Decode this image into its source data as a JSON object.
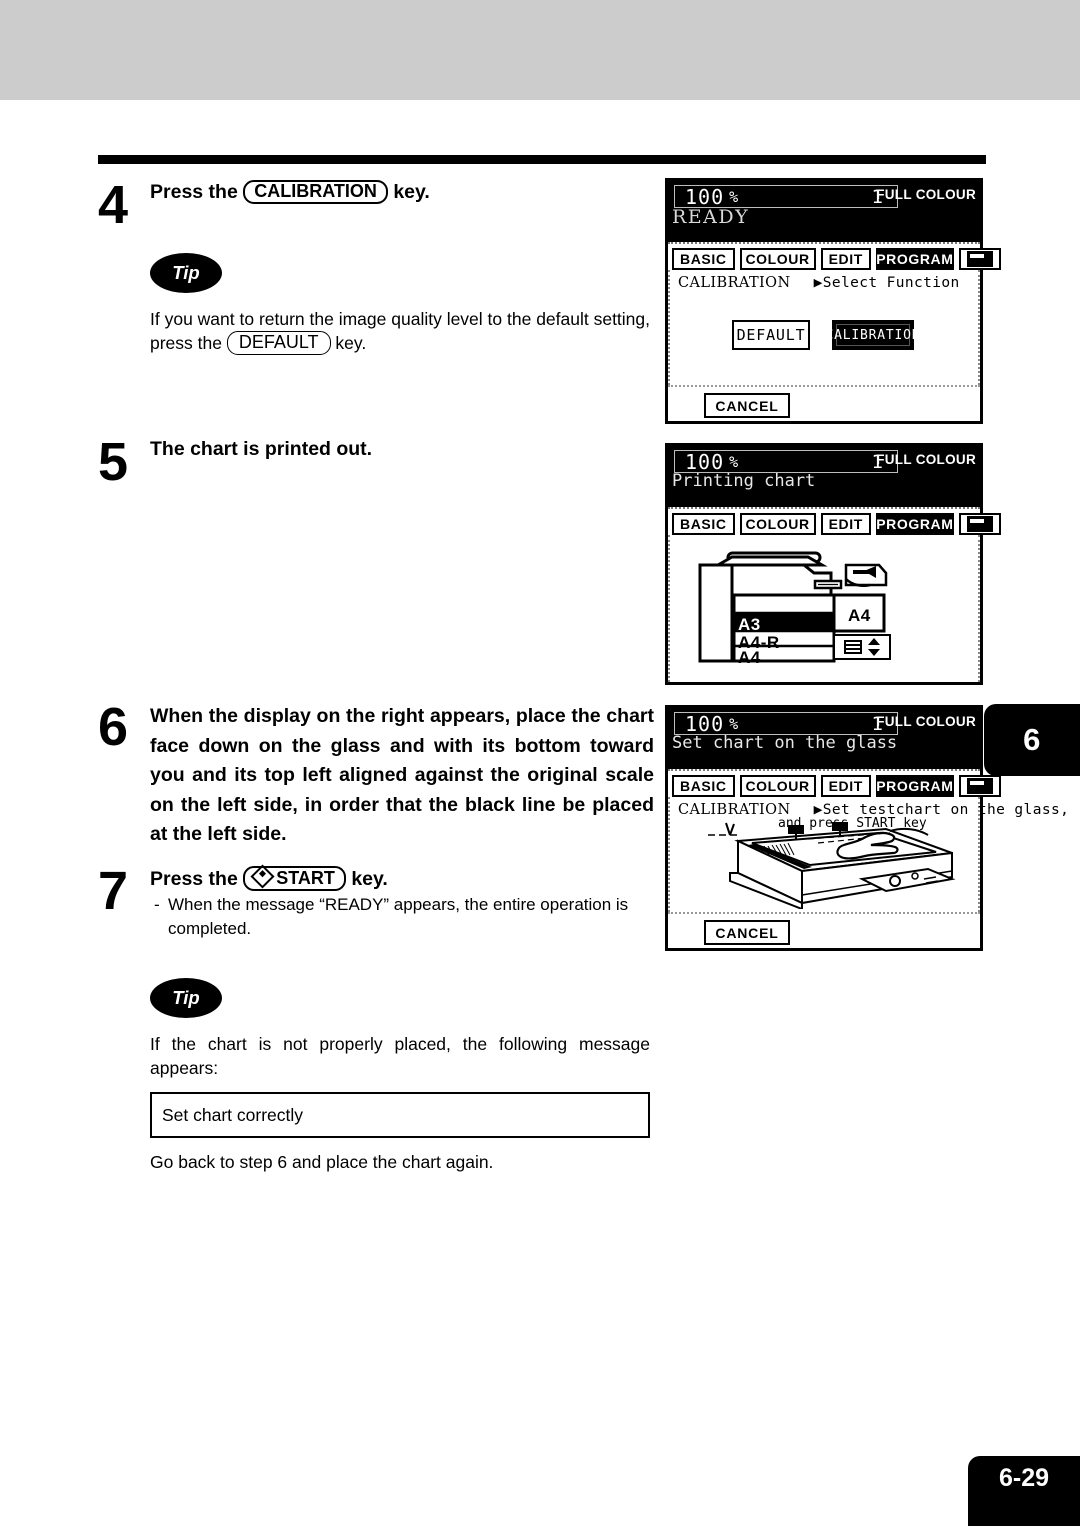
{
  "page": {
    "chapter_tab": "6",
    "page_number": "6-29"
  },
  "steps": [
    {
      "number": "4",
      "title_before": "Press the",
      "key": "CALIBRATION",
      "title_after": "key."
    },
    {
      "number": "5",
      "title": "The chart is printed out."
    },
    {
      "number": "6",
      "title": "When the display on the right appears, place the chart face down on the glass and with its bottom toward you and its top left aligned against the original scale on the left side, in order that the black line be placed at  the left side."
    },
    {
      "number": "7",
      "title_before": "Press the",
      "key": "START",
      "title_after": "key.",
      "dash": "-",
      "sub": "When the message “READY” appears,  the entire operation is completed."
    }
  ],
  "tips": [
    {
      "badge": "Tip",
      "text_before": "If you want to return the image quality level to the default setting, press the",
      "key": "DEFAULT",
      "text_after": "key."
    },
    {
      "badge": "Tip",
      "text": "If the chart is not properly placed, the following message appears:",
      "message_box": "Set chart correctly",
      "footer": "Go back to step 6 and place the chart again."
    }
  ],
  "lcd_panels": [
    {
      "id": "panel-calibration-select",
      "zoom": "100",
      "percent": "%",
      "copies": "1",
      "colour_mode": "FULL COLOUR",
      "message": "READY",
      "tabs": [
        {
          "label": "BASIC",
          "active": false
        },
        {
          "label": "COLOUR",
          "active": false
        },
        {
          "label": "EDIT",
          "active": false
        },
        {
          "label": "PROGRAM",
          "active": true
        },
        {
          "label": "keyboard-icon",
          "active": false
        }
      ],
      "function_label": "CALIBRATION",
      "function_prompt": "▶Select Function",
      "buttons": [
        {
          "label": "DEFAULT",
          "selected": false
        },
        {
          "label": "CALIBRATION",
          "selected": true
        }
      ],
      "cancel_label": "CANCEL"
    },
    {
      "id": "panel-printing-chart",
      "zoom": "100",
      "percent": "%",
      "copies": "1",
      "colour_mode": "FULL COLOUR",
      "message": "Printing chart",
      "tabs": [
        {
          "label": "BASIC",
          "active": false
        },
        {
          "label": "COLOUR",
          "active": false
        },
        {
          "label": "EDIT",
          "active": false
        },
        {
          "label": "PROGRAM",
          "active": true
        },
        {
          "label": "keyboard-icon",
          "active": false
        }
      ],
      "paper_sizes": [
        {
          "label": "",
          "selected": false
        },
        {
          "label": "A3",
          "selected": true
        },
        {
          "label": "A4-R",
          "selected": false
        },
        {
          "label": "A4",
          "selected": false
        }
      ],
      "bypass_label": "A4"
    },
    {
      "id": "panel-set-chart",
      "zoom": "100",
      "percent": "%",
      "copies": "1",
      "colour_mode": "FULL COLOUR",
      "message": "Set chart on the glass",
      "tabs": [
        {
          "label": "BASIC",
          "active": false
        },
        {
          "label": "COLOUR",
          "active": false
        },
        {
          "label": "EDIT",
          "active": false
        },
        {
          "label": "PROGRAM",
          "active": true
        },
        {
          "label": "keyboard-icon",
          "active": false
        }
      ],
      "function_label": "CALIBRATION",
      "function_prompt": "▶Set testchart on the glass,",
      "function_prompt2": "and press START key",
      "cancel_label": "CANCEL"
    }
  ]
}
